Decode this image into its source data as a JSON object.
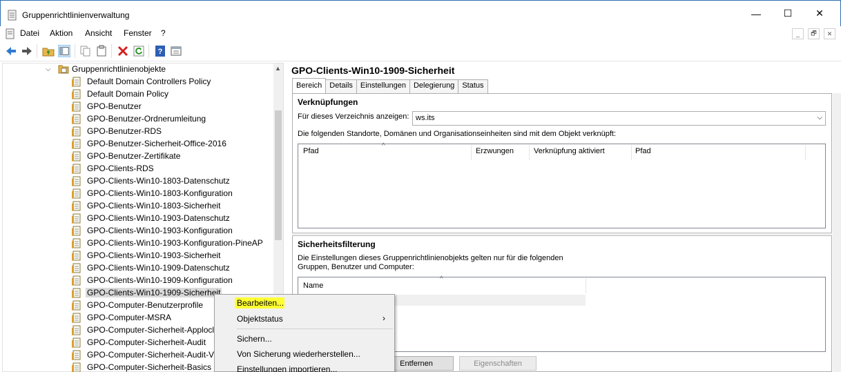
{
  "window": {
    "title": "Gruppenrichtlinienverwaltung",
    "min": "—",
    "max": "☐",
    "close": "✕"
  },
  "menu": [
    "Datei",
    "Aktion",
    "Ansicht",
    "Fenster",
    "?"
  ],
  "mdi": {
    "min": "_",
    "restore": "🗗",
    "close": "✕"
  },
  "tree": {
    "root": "Gruppenrichtlinienobjekte",
    "items": [
      "Default Domain Controllers Policy",
      "Default Domain Policy",
      "GPO-Benutzer",
      "GPO-Benutzer-Ordnerumleitung",
      "GPO-Benutzer-RDS",
      "GPO-Benutzer-Sicherheit-Office-2016",
      "GPO-Benutzer-Zertifikate",
      "GPO-Clients-RDS",
      "GPO-Clients-Win10-1803-Datenschutz",
      "GPO-Clients-Win10-1803-Konfiguration",
      "GPO-Clients-Win10-1803-Sicherheit",
      "GPO-Clients-Win10-1903-Datenschutz",
      "GPO-Clients-Win10-1903-Konfiguration",
      "GPO-Clients-Win10-1903-Konfiguration-PineAP",
      "GPO-Clients-Win10-1903-Sicherheit",
      "GPO-Clients-Win10-1909-Datenschutz",
      "GPO-Clients-Win10-1909-Konfiguration",
      "GPO-Clients-Win10-1909-Sicherheit",
      "GPO-Computer-Benutzerprofile",
      "GPO-Computer-MSRA",
      "GPO-Computer-Sicherheit-Applocl",
      "GPO-Computer-Sicherheit-Audit",
      "GPO-Computer-Sicherheit-Audit-V",
      "GPO-Computer-Sicherheit-Basics"
    ],
    "selected_index": 17
  },
  "detail": {
    "title": "GPO-Clients-Win10-1909-Sicherheit",
    "tabs": [
      "Bereich",
      "Details",
      "Einstellungen",
      "Delegierung",
      "Status"
    ],
    "links_heading": "Verknüpfungen",
    "dir_label": "Für dieses Verzeichnis anzeigen:",
    "dir_value": "ws.its",
    "links_desc": "Die folgenden Standorte, Domänen und Organisationseinheiten sind mit dem Objekt verknüpft:",
    "links_columns": [
      "Pfad",
      "Erzwungen",
      "Verknüpfung aktiviert",
      "Pfad"
    ],
    "security_heading": "Sicherheitsfilterung",
    "security_desc_1": "Die Einstellungen dieses Gruppenrichtlinienobjekts gelten nur für die folgenden",
    "security_desc_2": "Gruppen, Benutzer und Computer:",
    "security_column": "Name",
    "remove_btn": "Entfernen",
    "props_btn": "Eigenschaften"
  },
  "context_menu": {
    "edit": "Bearbeiten...",
    "status": "Objektstatus",
    "backup": "Sichern...",
    "restore": "Von Sicherung wiederherstellen...",
    "import": "Einstellungen importieren...",
    "highlight": "#ffff33"
  }
}
